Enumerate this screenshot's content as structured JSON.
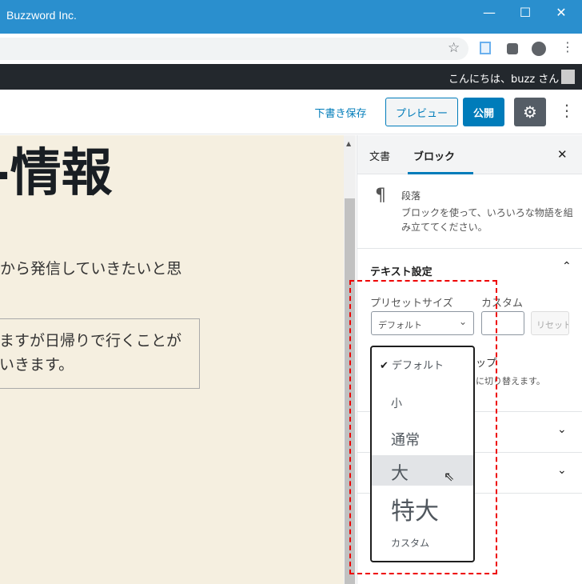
{
  "window": {
    "title": "Buzzword Inc.",
    "minimize": "—",
    "maximize": "☐",
    "close": "✕"
  },
  "browser": {
    "star_icon": "☆",
    "icons": [
      "tab-capture-icon",
      "puzzle-icon",
      "profile-icon",
      "more-icon"
    ]
  },
  "adminbar": {
    "greeting": "こんにちは、buzz さん"
  },
  "toolbar": {
    "save_draft": "下書き保存",
    "preview": "プレビュー",
    "publish": "公開",
    "more": "⋮"
  },
  "content": {
    "heading": "-情報",
    "paragraph": "から発信していきたいと思",
    "box_line1": "ますが日帰りで行くことが",
    "box_line2": "いきます。"
  },
  "sidebar": {
    "tabs": [
      {
        "label": "文書"
      },
      {
        "label": "ブロック",
        "active": true
      }
    ],
    "close": "✕",
    "block": {
      "icon": "¶",
      "name": "段落",
      "description": "ブロックを使って、いろいろな物語を組み立ててください。"
    },
    "text_settings": {
      "title": "テキスト設定",
      "preset_label": "プリセットサイズ",
      "custom_label": "カスタム",
      "preset_value": "デフォルト",
      "reset": "リセット",
      "hint1": "ップ",
      "hint2": "に切り替えます。"
    }
  },
  "dropdown": {
    "options": [
      {
        "label": "デフォルト",
        "selected": true
      },
      {
        "label": "小"
      },
      {
        "label": "通常"
      },
      {
        "label": "大",
        "hovered": true
      },
      {
        "label": "特大"
      },
      {
        "label": "カスタム"
      }
    ]
  },
  "colors": {
    "accent": "#007cba",
    "titlebar": "#2a8fce",
    "highlight": "#e00000"
  }
}
